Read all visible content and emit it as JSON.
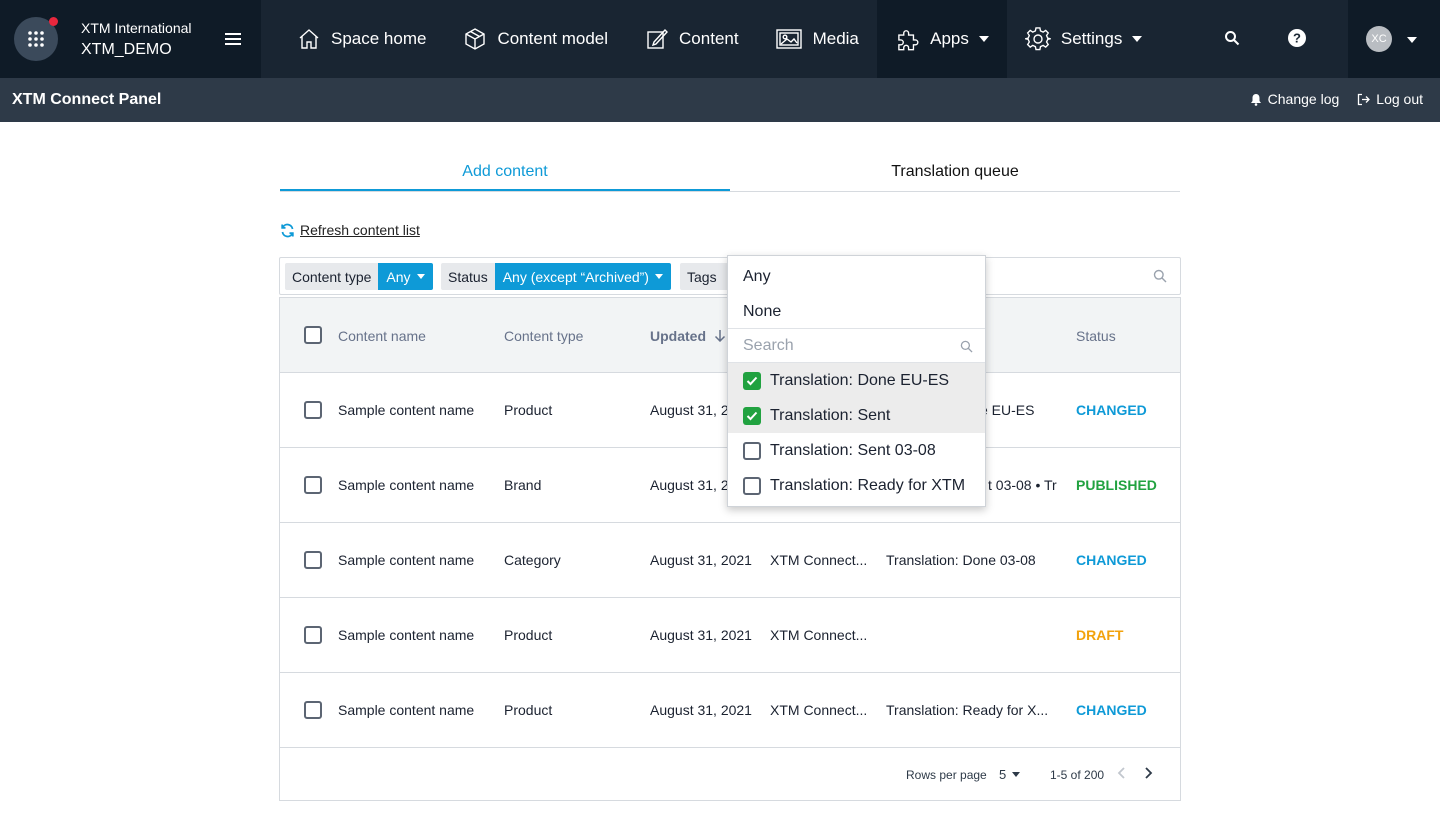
{
  "org": {
    "name": "XTM International",
    "space": "XTM_DEMO"
  },
  "nav": {
    "home": "Space home",
    "content_model": "Content model",
    "content": "Content",
    "media": "Media",
    "apps": "Apps",
    "settings": "Settings"
  },
  "user": {
    "initials": "XC"
  },
  "subbar": {
    "title": "XTM Connect Panel",
    "changelog": "Change log",
    "logout": "Log out"
  },
  "tabs": {
    "add_content": "Add content",
    "translation_queue": "Translation queue"
  },
  "refresh_label": "Refresh content list",
  "filters": {
    "content_type": {
      "label": "Content type",
      "value": "Any"
    },
    "status": {
      "label": "Status",
      "value": "Any (except “Archived”)"
    },
    "tags": {
      "label": "Tags"
    }
  },
  "table": {
    "headers": {
      "name": "Content name",
      "type": "Content type",
      "updated": "Updated",
      "status": "Status"
    },
    "rows": [
      {
        "name": "Sample content name",
        "type": "Product",
        "updated": "August 31, 2",
        "by": "",
        "tags": "e EU-ES",
        "status": "CHANGED"
      },
      {
        "name": "Sample content name",
        "type": "Brand",
        "updated": "August 31, 2",
        "by": "",
        "tags": "t 03-08  •  Tr",
        "status": "PUBLISHED"
      },
      {
        "name": "Sample content name",
        "type": "Category",
        "updated": "August 31, 2021",
        "by": "XTM Connect...",
        "tags": "Translation: Done 03-08",
        "status": "CHANGED"
      },
      {
        "name": "Sample content name",
        "type": "Product",
        "updated": "August 31, 2021",
        "by": "XTM Connect...",
        "tags": "",
        "status": "DRAFT"
      },
      {
        "name": "Sample content name",
        "type": "Product",
        "updated": "August 31, 2021",
        "by": "XTM Connect...",
        "tags": "Translation: Ready for X...",
        "status": "CHANGED"
      }
    ],
    "footer": {
      "rows_per_page_label": "Rows per page",
      "rows_per_page": "5",
      "range": "1-5 of 200"
    }
  },
  "dropdown": {
    "any": "Any",
    "none": "None",
    "search_placeholder": "Search",
    "items": [
      {
        "label": "Translation: Done EU-ES",
        "checked": true
      },
      {
        "label": "Translation: Sent",
        "checked": true
      },
      {
        "label": "Translation: Sent 03-08",
        "checked": false
      },
      {
        "label": "Translation: Ready for XTM",
        "checked": false
      }
    ]
  },
  "colors": {
    "accent": "#0e9ad7",
    "nav_bg": "#192532",
    "published": "#21a240",
    "draft": "#f2a20c"
  }
}
